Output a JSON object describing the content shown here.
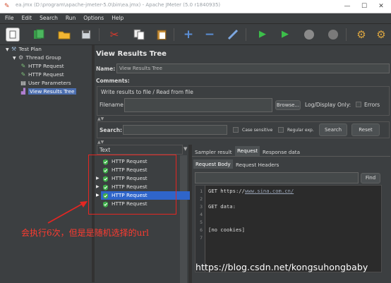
{
  "window": {
    "title": "ea.jmx (D:\\program\\apache-jmeter-5.0\\bin\\ea.jmx) - Apache JMeter (5.0 r1840935)"
  },
  "menu": [
    "File",
    "Edit",
    "Search",
    "Run",
    "Options",
    "Help"
  ],
  "toolbar": [
    "new-icon",
    "templates-icon",
    "open-icon",
    "save-icon",
    "cut-icon",
    "copy-icon",
    "paste-icon",
    "expand-icon",
    "collapse-icon",
    "toggle-icon",
    "start-icon",
    "start-no-pause-icon",
    "stop-icon",
    "shutdown-icon",
    "clear-icon",
    "clear-all-icon"
  ],
  "tree": {
    "items": [
      {
        "label": "Test Plan",
        "icon": "test-plan-icon"
      },
      {
        "label": "Thread Group",
        "icon": "thread-group-icon"
      },
      {
        "label": "HTTP Request",
        "icon": "sampler-icon"
      },
      {
        "label": "HTTP Request",
        "icon": "sampler-icon"
      },
      {
        "label": "User Parameters",
        "icon": "preprocessor-icon"
      },
      {
        "label": "View Results Tree",
        "icon": "listener-icon"
      }
    ]
  },
  "panel": {
    "title": "View Results Tree",
    "name_label": "Name:",
    "name_value": "View Results Tree",
    "comments_label": "Comments:",
    "write_section": "Write results to file / Read from file",
    "filename_label": "Filename",
    "filename_value": "",
    "browse_label": "Browse...",
    "log_display_label": "Log/Display Only:",
    "errors_label": "Errors",
    "search_label": "Search:",
    "search_value": "",
    "case_sensitive_label": "Case sensitive",
    "regex_label": "Regular exp.",
    "search_button": "Search",
    "reset_button": "Reset",
    "text_column": "Text"
  },
  "results": [
    {
      "label": "HTTP Request",
      "selected": false
    },
    {
      "label": "HTTP Request",
      "selected": false
    },
    {
      "label": "HTTP Request",
      "selected": false
    },
    {
      "label": "HTTP Request",
      "selected": false
    },
    {
      "label": "HTTP Request",
      "selected": true
    },
    {
      "label": "HTTP Request",
      "selected": false
    }
  ],
  "tabs": {
    "main": [
      "Sampler result",
      "Request",
      "Response data"
    ],
    "active_main": "Request",
    "sub": [
      "Request Body",
      "Request Headers"
    ],
    "active_sub": "Request Body",
    "find_button": "Find"
  },
  "request_body": {
    "lines": [
      {
        "n": "1",
        "text": "GET https://www.sina.com.cn/"
      },
      {
        "n": "2",
        "text": ""
      },
      {
        "n": "3",
        "text": "GET data:"
      },
      {
        "n": "4",
        "text": ""
      },
      {
        "n": "5",
        "text": ""
      },
      {
        "n": "6",
        "text": "[no cookies]"
      },
      {
        "n": "7",
        "text": ""
      }
    ]
  },
  "annotation": "会执行6次，但是是随机选择的url",
  "watermark": "https://blog.csdn.net/kongsuhongbaby",
  "colors": {
    "background": "#3c3f41",
    "selection": "#2f65ca",
    "highlight_box": "#e52622",
    "annotation": "#ff3b30"
  }
}
